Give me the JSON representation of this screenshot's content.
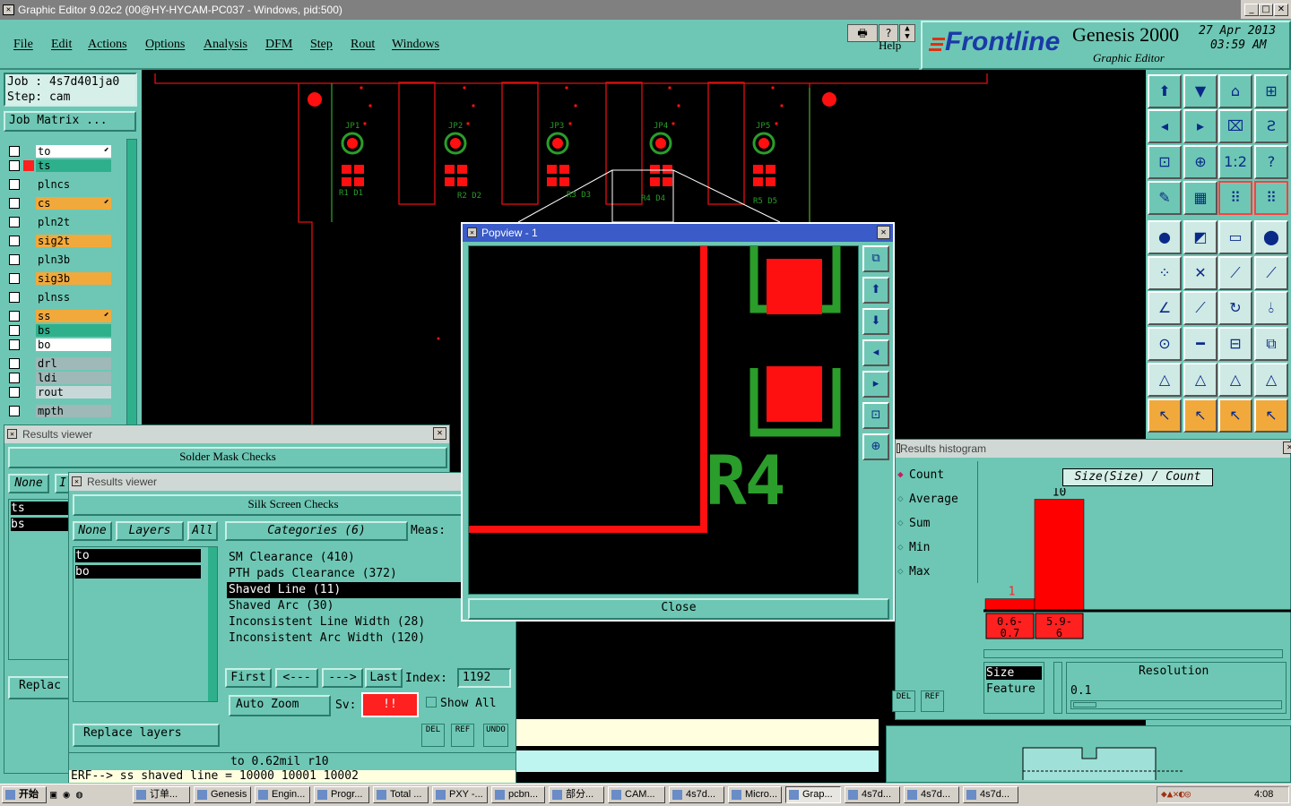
{
  "window": {
    "title": "Graphic Editor 9.02c2 (00@HY-HYCAM-PC037 - Windows, pid:500)",
    "min": "_",
    "max": "□",
    "close": "✕"
  },
  "menu": {
    "file": "File",
    "edit": "Edit",
    "actions": "Actions",
    "options": "Options",
    "analysis": "Analysis",
    "dfm": "DFM",
    "step": "Step",
    "rout": "Rout",
    "windows": "Windows",
    "help": "Help"
  },
  "brand": {
    "logo": "Frontline",
    "product": "Genesis 2000",
    "subtitle": "Graphic Editor",
    "date": "27 Apr 2013",
    "time": "03:59 AM"
  },
  "job": {
    "job_label": "Job : 4s7d401ja0",
    "step_label": "Step: cam",
    "matrix_btn": "Job Matrix ..."
  },
  "layers": [
    {
      "name": "to",
      "color": "#ffffff"
    },
    {
      "name": "ts",
      "color": "#2fb08c"
    },
    {
      "name": "plncs",
      "color": "#6ec7b4"
    },
    {
      "name": "cs",
      "color": "#f2a93b"
    },
    {
      "name": "pln2t",
      "color": "#6ec7b4"
    },
    {
      "name": "sig2t",
      "color": "#f2a93b"
    },
    {
      "name": "pln3b",
      "color": "#6ec7b4"
    },
    {
      "name": "sig3b",
      "color": "#f2a93b"
    },
    {
      "name": "plnss",
      "color": "#6ec7b4"
    },
    {
      "name": "ss",
      "color": "#f2a93b"
    },
    {
      "name": "bs",
      "color": "#2fb08c"
    },
    {
      "name": "bo",
      "color": "#ffffff"
    },
    {
      "name": "drl",
      "color": "#9fb8b8"
    },
    {
      "name": "ldi",
      "color": "#9fb8b8"
    },
    {
      "name": "rout",
      "color": "#c8d8d8"
    },
    {
      "name": "mpth",
      "color": "#9fb8b8"
    }
  ],
  "board_labels": [
    "JP1",
    "JP2",
    "JP3",
    "JP4",
    "JP5",
    "R1 D1",
    "R2 D2",
    "R3 D3",
    "R4 D4",
    "R5 D5"
  ],
  "rv1": {
    "title": "Results viewer",
    "header": "Solder Mask Checks",
    "none": "None",
    "layers_short": "I",
    "items": [
      "ts",
      "bs"
    ],
    "replace": "Replac"
  },
  "rv2": {
    "title": "Results viewer",
    "header": "Silk Screen Checks",
    "none": "None",
    "layers": "Layers",
    "all": "All",
    "categories": "Categories (6)",
    "meas": "Meas:",
    "layer_items": [
      "to",
      "bo"
    ],
    "cats": [
      "SM Clearance (410)",
      "PTH pads Clearance (372)",
      "Shaved Line (11)",
      "Shaved Arc (30)",
      "Inconsistent Line Width (28)",
      "Inconsistent Arc Width (120)"
    ],
    "first": "First",
    "prev": "<---",
    "next": "--->",
    "last": "Last",
    "index_label": "Index:",
    "index_value": "1192",
    "autozoom": "Auto Zoom",
    "sv": "Sv:",
    "sv_value": "!!",
    "showall": "Show All",
    "replace_layers": "Replace layers",
    "del": "DEL",
    "ref": "REF",
    "undo": "UNDO",
    "status1": "to 0.62mil r10",
    "status2": "ERF--> ss shaved line = 10000 10001 10002"
  },
  "popview": {
    "title": "Popview - 1",
    "close": "Close",
    "label": "R4"
  },
  "histogram": {
    "title": "Results histogram",
    "count": "Count",
    "average": "Average",
    "sum": "Sum",
    "min": "Min",
    "max": "Max",
    "chart_title": "Size(Size) / Count",
    "size": "Size",
    "feature": "Feature",
    "resolution": "Resolution",
    "resolution_value": "0.1",
    "del": "DEL",
    "ref": "REF"
  },
  "chart_data": {
    "type": "bar",
    "title": "Size(Size) / Count",
    "categories": [
      "0.6-0.7",
      "5.9-6"
    ],
    "values": [
      1,
      10
    ],
    "colors": [
      "#ff0000"
    ]
  },
  "taskbar": {
    "start": "开始",
    "items": [
      "订单...",
      "Genesis",
      "Engin...",
      "Progr...",
      "Total ...",
      "PXY -...",
      "pcbn...",
      "部分...",
      "CAM...",
      "4s7d...",
      "Micro...",
      "Grap...",
      "4s7d...",
      "4s7d...",
      "4s7d..."
    ],
    "clock": "4:08"
  }
}
